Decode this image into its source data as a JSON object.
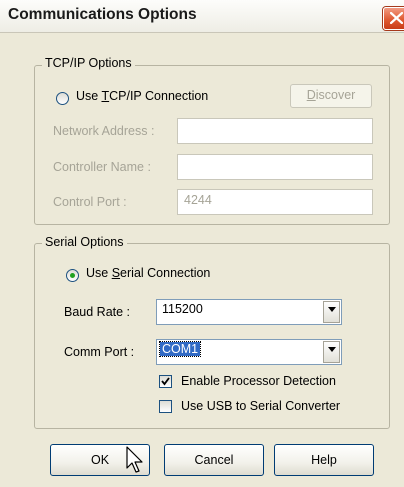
{
  "window": {
    "title": "Communications Options"
  },
  "tcpip": {
    "legend": "TCP/IP Options",
    "use_tcpip_pre": "Use ",
    "use_tcpip_ul": "T",
    "use_tcpip_post": "CP/IP Connection",
    "use_tcpip_selected": false,
    "discover_ul": "D",
    "discover_post": "iscover",
    "network_address_label": "Network Address :",
    "network_address_value": "",
    "controller_name_label": "Controller Name :",
    "controller_name_value": "",
    "control_port_label": "Control Port :",
    "control_port_value": "4244"
  },
  "serial": {
    "legend": "Serial Options",
    "use_serial_pre": "Use ",
    "use_serial_ul": "S",
    "use_serial_post": "erial Connection",
    "use_serial_selected": true,
    "baud_rate_label": "Baud Rate :",
    "baud_rate_value": "115200",
    "comm_port_label": "Comm Port :",
    "comm_port_value": "COM1",
    "enable_processor_detection_label": "Enable Processor Detection",
    "enable_processor_detection_checked": true,
    "use_usb_label": "Use USB to Serial Converter",
    "use_usb_checked": false
  },
  "buttons": {
    "ok": "OK",
    "cancel": "Cancel",
    "help": "Help"
  },
  "icons": {
    "close": "close-icon",
    "dropdown": "chevron-down-icon",
    "checkmark": "checkmark-icon",
    "cursor": "mouse-pointer-icon"
  }
}
